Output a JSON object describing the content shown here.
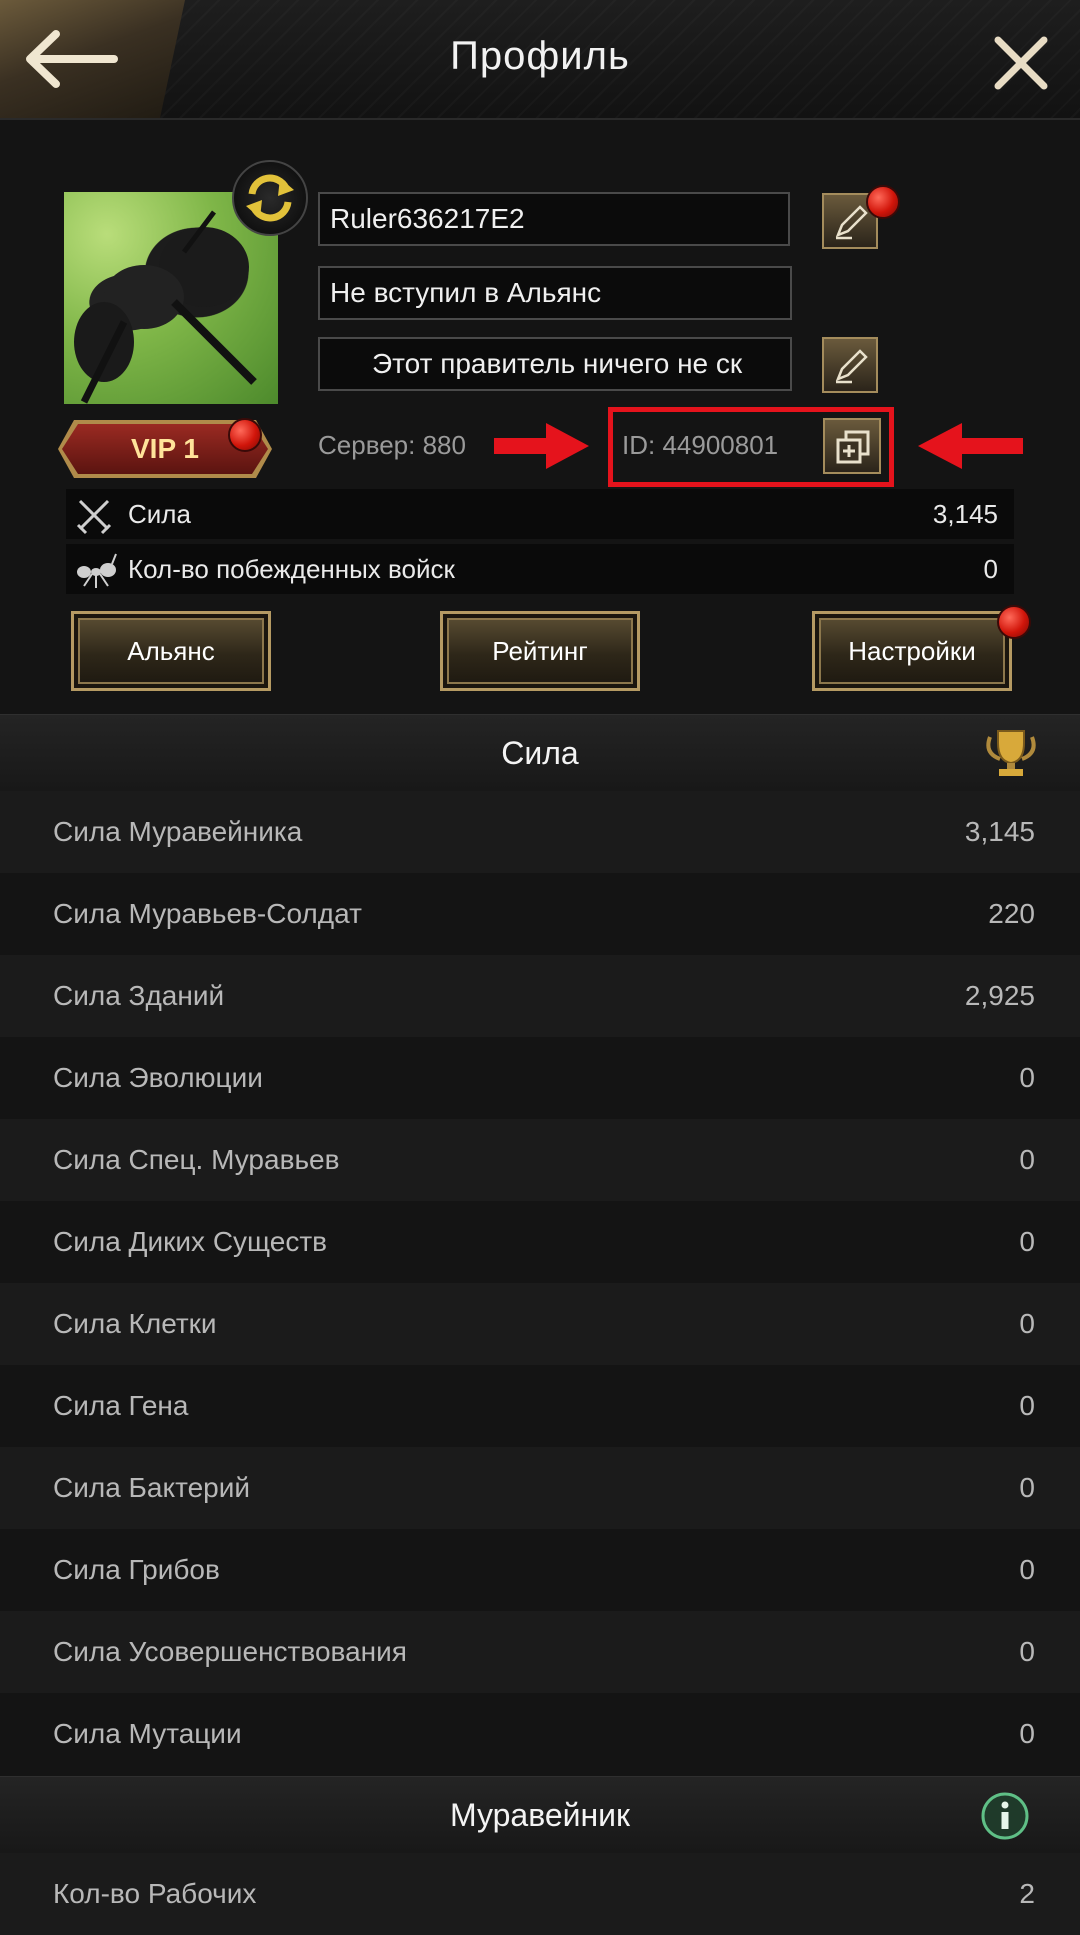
{
  "header": {
    "title": "Профиль"
  },
  "profile": {
    "name": "Ruler636217E2",
    "alliance": "Не вступил в Альянс",
    "motto": "Этот правитель ничего не ск",
    "vip": "VIP 1",
    "server": "Сервер: 880",
    "id": "ID: 44900801"
  },
  "stats": [
    {
      "label": "Сила",
      "value": "3,145",
      "icon": "crossed-swords-icon"
    },
    {
      "label": "Кол-во побежденных войск",
      "value": "0",
      "icon": "ant-icon"
    }
  ],
  "buttons": {
    "alliance": "Альянс",
    "rating": "Рейтинг",
    "settings": "Настройки"
  },
  "power_section": {
    "title": "Сила",
    "rows": [
      {
        "label": "Сила Муравейника",
        "value": "3,145"
      },
      {
        "label": "Сила Муравьев-Солдат",
        "value": "220"
      },
      {
        "label": "Сила Зданий",
        "value": "2,925"
      },
      {
        "label": "Сила Эволюции",
        "value": "0"
      },
      {
        "label": "Сила Спец. Муравьев",
        "value": "0"
      },
      {
        "label": "Сила Диких Существ",
        "value": "0"
      },
      {
        "label": "Сила Клетки",
        "value": "0"
      },
      {
        "label": "Сила Гена",
        "value": "0"
      },
      {
        "label": "Сила Бактерий",
        "value": "0"
      },
      {
        "label": "Сила Грибов",
        "value": "0"
      },
      {
        "label": "Сила Усовершенствования",
        "value": "0"
      },
      {
        "label": "Сила Мутации",
        "value": "0"
      }
    ]
  },
  "anthill_section": {
    "title": "Муравейник",
    "rows": [
      {
        "label": "Кол-во Рабочих",
        "value": "2"
      }
    ]
  },
  "colors": {
    "highlight": "#e5131c",
    "gold": "#b59a63",
    "notification": "#d1150a"
  }
}
